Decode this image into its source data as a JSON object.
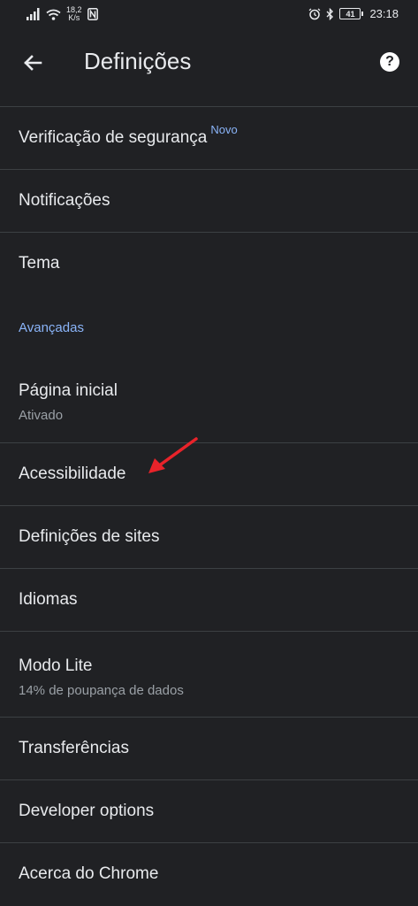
{
  "status_bar": {
    "net_speed_value": "18,2",
    "net_speed_unit": "K/s",
    "battery": "41",
    "time": "23:18"
  },
  "header": {
    "title": "Definições"
  },
  "items": {
    "safety_check": {
      "label": "Verificação de segurança",
      "badge": "Novo"
    },
    "notifications": {
      "label": "Notificações"
    },
    "theme": {
      "label": "Tema"
    },
    "advanced_header": "Avançadas",
    "homepage": {
      "label": "Página inicial",
      "sub": "Ativado"
    },
    "accessibility": {
      "label": "Acessibilidade"
    },
    "site_settings": {
      "label": "Definições de sites"
    },
    "languages": {
      "label": "Idiomas"
    },
    "lite_mode": {
      "label": "Modo Lite",
      "sub": "14% de poupança de dados"
    },
    "downloads": {
      "label": "Transferências"
    },
    "developer": {
      "label": "Developer options"
    },
    "about": {
      "label": "Acerca do Chrome"
    }
  },
  "icons": {
    "back": "arrow-back-icon",
    "help": "help-icon",
    "signal": "signal-icon",
    "wifi": "wifi-icon",
    "nfc": "nfc-icon",
    "alarm": "alarm-icon",
    "bluetooth": "bluetooth-icon",
    "battery": "battery-icon"
  },
  "colors": {
    "background": "#202124",
    "accent": "#8ab4f8",
    "annotation_arrow": "#e8232a"
  }
}
